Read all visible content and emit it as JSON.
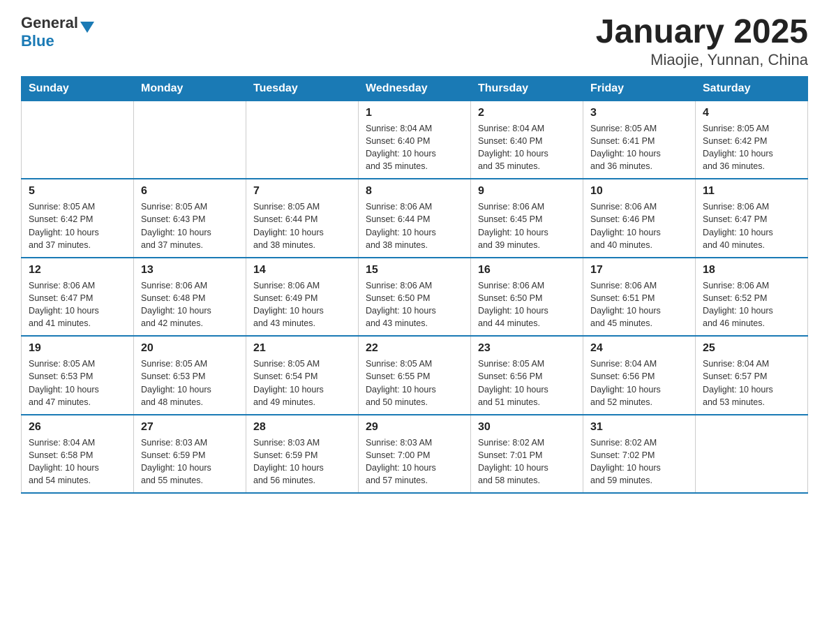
{
  "logo": {
    "general": "General",
    "blue": "Blue"
  },
  "title": "January 2025",
  "subtitle": "Miaojie, Yunnan, China",
  "weekdays": [
    "Sunday",
    "Monday",
    "Tuesday",
    "Wednesday",
    "Thursday",
    "Friday",
    "Saturday"
  ],
  "weeks": [
    [
      {
        "day": "",
        "info": ""
      },
      {
        "day": "",
        "info": ""
      },
      {
        "day": "",
        "info": ""
      },
      {
        "day": "1",
        "info": "Sunrise: 8:04 AM\nSunset: 6:40 PM\nDaylight: 10 hours\nand 35 minutes."
      },
      {
        "day": "2",
        "info": "Sunrise: 8:04 AM\nSunset: 6:40 PM\nDaylight: 10 hours\nand 35 minutes."
      },
      {
        "day": "3",
        "info": "Sunrise: 8:05 AM\nSunset: 6:41 PM\nDaylight: 10 hours\nand 36 minutes."
      },
      {
        "day": "4",
        "info": "Sunrise: 8:05 AM\nSunset: 6:42 PM\nDaylight: 10 hours\nand 36 minutes."
      }
    ],
    [
      {
        "day": "5",
        "info": "Sunrise: 8:05 AM\nSunset: 6:42 PM\nDaylight: 10 hours\nand 37 minutes."
      },
      {
        "day": "6",
        "info": "Sunrise: 8:05 AM\nSunset: 6:43 PM\nDaylight: 10 hours\nand 37 minutes."
      },
      {
        "day": "7",
        "info": "Sunrise: 8:05 AM\nSunset: 6:44 PM\nDaylight: 10 hours\nand 38 minutes."
      },
      {
        "day": "8",
        "info": "Sunrise: 8:06 AM\nSunset: 6:44 PM\nDaylight: 10 hours\nand 38 minutes."
      },
      {
        "day": "9",
        "info": "Sunrise: 8:06 AM\nSunset: 6:45 PM\nDaylight: 10 hours\nand 39 minutes."
      },
      {
        "day": "10",
        "info": "Sunrise: 8:06 AM\nSunset: 6:46 PM\nDaylight: 10 hours\nand 40 minutes."
      },
      {
        "day": "11",
        "info": "Sunrise: 8:06 AM\nSunset: 6:47 PM\nDaylight: 10 hours\nand 40 minutes."
      }
    ],
    [
      {
        "day": "12",
        "info": "Sunrise: 8:06 AM\nSunset: 6:47 PM\nDaylight: 10 hours\nand 41 minutes."
      },
      {
        "day": "13",
        "info": "Sunrise: 8:06 AM\nSunset: 6:48 PM\nDaylight: 10 hours\nand 42 minutes."
      },
      {
        "day": "14",
        "info": "Sunrise: 8:06 AM\nSunset: 6:49 PM\nDaylight: 10 hours\nand 43 minutes."
      },
      {
        "day": "15",
        "info": "Sunrise: 8:06 AM\nSunset: 6:50 PM\nDaylight: 10 hours\nand 43 minutes."
      },
      {
        "day": "16",
        "info": "Sunrise: 8:06 AM\nSunset: 6:50 PM\nDaylight: 10 hours\nand 44 minutes."
      },
      {
        "day": "17",
        "info": "Sunrise: 8:06 AM\nSunset: 6:51 PM\nDaylight: 10 hours\nand 45 minutes."
      },
      {
        "day": "18",
        "info": "Sunrise: 8:06 AM\nSunset: 6:52 PM\nDaylight: 10 hours\nand 46 minutes."
      }
    ],
    [
      {
        "day": "19",
        "info": "Sunrise: 8:05 AM\nSunset: 6:53 PM\nDaylight: 10 hours\nand 47 minutes."
      },
      {
        "day": "20",
        "info": "Sunrise: 8:05 AM\nSunset: 6:53 PM\nDaylight: 10 hours\nand 48 minutes."
      },
      {
        "day": "21",
        "info": "Sunrise: 8:05 AM\nSunset: 6:54 PM\nDaylight: 10 hours\nand 49 minutes."
      },
      {
        "day": "22",
        "info": "Sunrise: 8:05 AM\nSunset: 6:55 PM\nDaylight: 10 hours\nand 50 minutes."
      },
      {
        "day": "23",
        "info": "Sunrise: 8:05 AM\nSunset: 6:56 PM\nDaylight: 10 hours\nand 51 minutes."
      },
      {
        "day": "24",
        "info": "Sunrise: 8:04 AM\nSunset: 6:56 PM\nDaylight: 10 hours\nand 52 minutes."
      },
      {
        "day": "25",
        "info": "Sunrise: 8:04 AM\nSunset: 6:57 PM\nDaylight: 10 hours\nand 53 minutes."
      }
    ],
    [
      {
        "day": "26",
        "info": "Sunrise: 8:04 AM\nSunset: 6:58 PM\nDaylight: 10 hours\nand 54 minutes."
      },
      {
        "day": "27",
        "info": "Sunrise: 8:03 AM\nSunset: 6:59 PM\nDaylight: 10 hours\nand 55 minutes."
      },
      {
        "day": "28",
        "info": "Sunrise: 8:03 AM\nSunset: 6:59 PM\nDaylight: 10 hours\nand 56 minutes."
      },
      {
        "day": "29",
        "info": "Sunrise: 8:03 AM\nSunset: 7:00 PM\nDaylight: 10 hours\nand 57 minutes."
      },
      {
        "day": "30",
        "info": "Sunrise: 8:02 AM\nSunset: 7:01 PM\nDaylight: 10 hours\nand 58 minutes."
      },
      {
        "day": "31",
        "info": "Sunrise: 8:02 AM\nSunset: 7:02 PM\nDaylight: 10 hours\nand 59 minutes."
      },
      {
        "day": "",
        "info": ""
      }
    ]
  ]
}
